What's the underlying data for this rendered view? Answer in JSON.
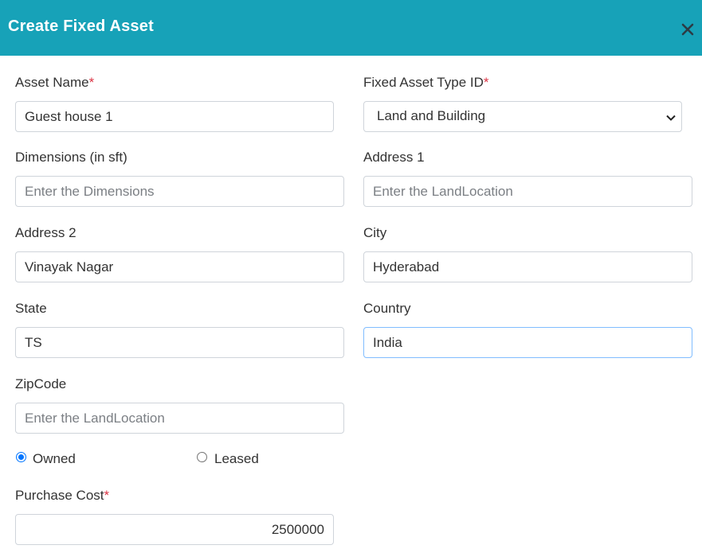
{
  "dialog": {
    "title": "Create Fixed Asset",
    "close_icon": "close-icon"
  },
  "form": {
    "asset_name": {
      "label": "Asset Name",
      "required_mark": "*",
      "value": "Guest house 1"
    },
    "fixed_asset_type": {
      "label": "Fixed Asset Type ID",
      "required_mark": "*",
      "selected": "Land and Building",
      "icon": "chevron-down-icon"
    },
    "dimensions": {
      "label": "Dimensions (in sft)",
      "value": "",
      "placeholder": "Enter the Dimensions"
    },
    "address1": {
      "label": "Address 1",
      "value": "",
      "placeholder": "Enter the LandLocation"
    },
    "address2": {
      "label": "Address 2",
      "value": "Vinayak Nagar"
    },
    "city": {
      "label": "City",
      "value": "Hyderabad"
    },
    "state": {
      "label": "State",
      "value": "TS"
    },
    "country": {
      "label": "Country",
      "value": "India"
    },
    "zipcode": {
      "label": "ZipCode",
      "value": "",
      "placeholder": "Enter the LandLocation"
    },
    "ownership": {
      "options": [
        {
          "label": "Owned",
          "checked": true
        },
        {
          "label": "Leased",
          "checked": false
        }
      ]
    },
    "purchase_cost": {
      "label": "Purchase Cost",
      "required_mark": "*",
      "value": "2500000"
    }
  },
  "colors": {
    "header_bg": "#17a2b8",
    "header_text": "#ffffff",
    "required": "#dc3545",
    "radio_accent": "#0075ff",
    "focus_border": "#80bdff"
  }
}
